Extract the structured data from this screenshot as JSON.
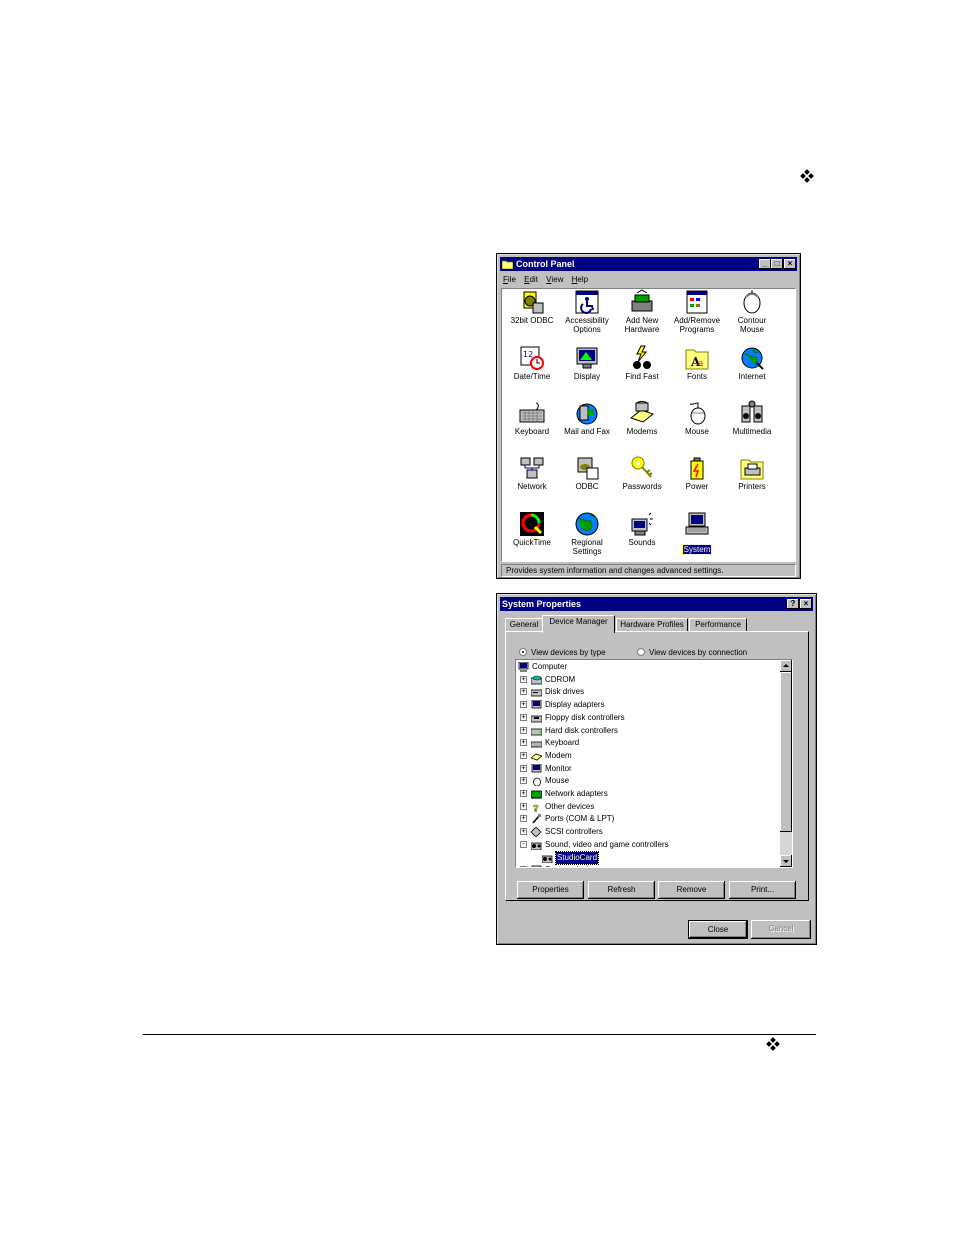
{
  "control_panel": {
    "title": "Control Panel",
    "menu": [
      {
        "accel": "F",
        "rest": "ile"
      },
      {
        "accel": "E",
        "rest": "dit"
      },
      {
        "accel": "V",
        "rest": "iew"
      },
      {
        "accel": "H",
        "rest": "elp"
      }
    ],
    "icons": [
      {
        "l1": "32bit ODBC",
        "l2": "",
        "icon": "odbc-32-icon"
      },
      {
        "l1": "Accessibility",
        "l2": "Options",
        "icon": "accessibility-icon"
      },
      {
        "l1": "Add New",
        "l2": "Hardware",
        "icon": "add-hardware-icon"
      },
      {
        "l1": "Add/Remove",
        "l2": "Programs",
        "icon": "add-remove-programs-icon"
      },
      {
        "l1": "Contour",
        "l2": "Mouse",
        "icon": "contour-mouse-icon"
      },
      {
        "l1": "Date/Time",
        "l2": "",
        "icon": "date-time-icon"
      },
      {
        "l1": "Display",
        "l2": "",
        "icon": "display-icon"
      },
      {
        "l1": "Find Fast",
        "l2": "",
        "icon": "find-fast-icon"
      },
      {
        "l1": "Fonts",
        "l2": "",
        "icon": "fonts-icon"
      },
      {
        "l1": "Internet",
        "l2": "",
        "icon": "internet-icon"
      },
      {
        "l1": "Keyboard",
        "l2": "",
        "icon": "keyboard-icon"
      },
      {
        "l1": "Mail and Fax",
        "l2": "",
        "icon": "mail-fax-icon"
      },
      {
        "l1": "Modems",
        "l2": "",
        "icon": "modems-icon"
      },
      {
        "l1": "Mouse",
        "l2": "",
        "icon": "mouse-icon"
      },
      {
        "l1": "Multimedia",
        "l2": "",
        "icon": "multimedia-icon"
      },
      {
        "l1": "Network",
        "l2": "",
        "icon": "network-icon"
      },
      {
        "l1": "ODBC",
        "l2": "",
        "icon": "odbc-icon"
      },
      {
        "l1": "Passwords",
        "l2": "",
        "icon": "passwords-icon"
      },
      {
        "l1": "Power",
        "l2": "",
        "icon": "power-icon"
      },
      {
        "l1": "Printers",
        "l2": "",
        "icon": "printers-icon"
      },
      {
        "l1": "QuickTime",
        "l2": "",
        "icon": "quicktime-icon"
      },
      {
        "l1": "Regional",
        "l2": "Settings",
        "icon": "regional-settings-icon"
      },
      {
        "l1": "Sounds",
        "l2": "",
        "icon": "sounds-icon"
      },
      {
        "l1": "System",
        "l2": "",
        "icon": "system-icon",
        "selected": true
      }
    ],
    "status": "Provides system information and changes advanced settings."
  },
  "system_properties": {
    "title": "System Properties",
    "tabs": [
      "General",
      "Device Manager",
      "Hardware Profiles",
      "Performance"
    ],
    "active_tab": "Device Manager",
    "radio_by_type": "View devices by type",
    "radio_by_connection": "View devices by connection",
    "tree": [
      {
        "label": "Computer",
        "level": 0,
        "exp": "",
        "icon": "computer-icon"
      },
      {
        "label": "CDROM",
        "level": 1,
        "exp": "+",
        "icon": "cdrom-icon"
      },
      {
        "label": "Disk drives",
        "level": 1,
        "exp": "+",
        "icon": "disk-drive-icon"
      },
      {
        "label": "Display adapters",
        "level": 1,
        "exp": "+",
        "icon": "display-adapter-icon"
      },
      {
        "label": "Floppy disk controllers",
        "level": 1,
        "exp": "+",
        "icon": "floppy-controller-icon"
      },
      {
        "label": "Hard disk controllers",
        "level": 1,
        "exp": "+",
        "icon": "hard-disk-controller-icon"
      },
      {
        "label": "Keyboard",
        "level": 1,
        "exp": "+",
        "icon": "keyboard-device-icon"
      },
      {
        "label": "Modem",
        "level": 1,
        "exp": "+",
        "icon": "modem-device-icon"
      },
      {
        "label": "Monitor",
        "level": 1,
        "exp": "+",
        "icon": "monitor-icon"
      },
      {
        "label": "Mouse",
        "level": 1,
        "exp": "+",
        "icon": "mouse-device-icon"
      },
      {
        "label": "Network adapters",
        "level": 1,
        "exp": "+",
        "icon": "network-adapter-icon"
      },
      {
        "label": "Other devices",
        "level": 1,
        "exp": "+",
        "icon": "other-devices-icon"
      },
      {
        "label": "Ports (COM & LPT)",
        "level": 1,
        "exp": "+",
        "icon": "ports-icon"
      },
      {
        "label": "SCSI controllers",
        "level": 1,
        "exp": "+",
        "icon": "scsi-icon"
      },
      {
        "label": "Sound, video and game controllers",
        "level": 1,
        "exp": "-",
        "icon": "sound-controller-icon"
      },
      {
        "label": "StudioCard",
        "level": 2,
        "exp": "",
        "icon": "studiocard-icon",
        "selected": true
      },
      {
        "label": "System devices",
        "level": 1,
        "exp": "+",
        "icon": "system-devices-icon"
      }
    ],
    "buttons": {
      "properties": "Properties",
      "refresh": "Refresh",
      "remove": "Remove",
      "print": "Print...",
      "close": "Close",
      "cancel": "Cancel"
    }
  }
}
